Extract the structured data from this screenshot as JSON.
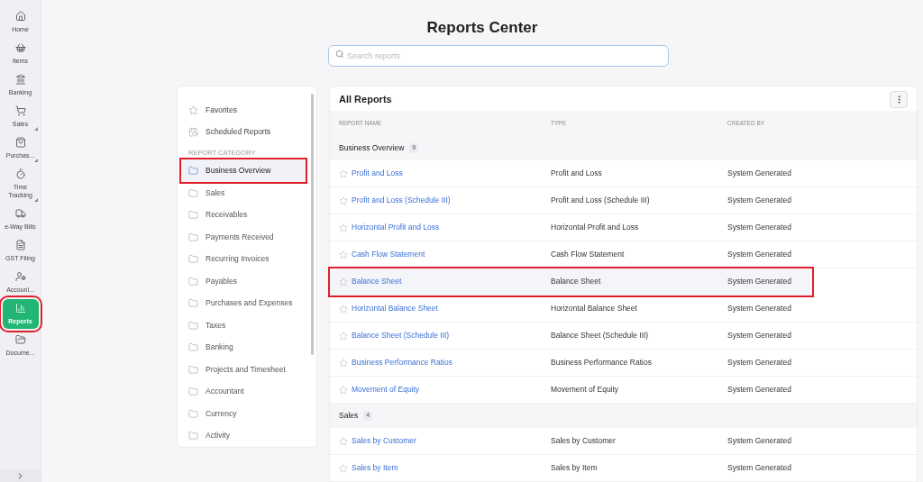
{
  "nav": {
    "items": [
      {
        "label": "Home",
        "selected": false,
        "expandable": false,
        "annotated": false
      },
      {
        "label": "Items",
        "selected": false,
        "expandable": false,
        "annotated": false
      },
      {
        "label": "Banking",
        "selected": false,
        "expandable": false,
        "annotated": false
      },
      {
        "label": "Sales",
        "selected": false,
        "expandable": true,
        "annotated": false
      },
      {
        "label": "Purchas...",
        "selected": false,
        "expandable": true,
        "annotated": false
      },
      {
        "label": "Time Tracking",
        "selected": false,
        "expandable": true,
        "annotated": false
      },
      {
        "label": "e-Way Bills",
        "selected": false,
        "expandable": false,
        "annotated": false
      },
      {
        "label": "GST Filing",
        "selected": false,
        "expandable": false,
        "annotated": false
      },
      {
        "label": "Accounl...",
        "selected": false,
        "expandable": false,
        "annotated": false
      },
      {
        "label": "Reports",
        "selected": true,
        "expandable": false,
        "annotated": true
      },
      {
        "label": "Docume...",
        "selected": false,
        "expandable": false,
        "annotated": false
      }
    ]
  },
  "title": "Reports Center",
  "search": {
    "placeholder": "Search reports"
  },
  "categories": {
    "top": [
      {
        "label": "Favorites"
      },
      {
        "label": "Scheduled Reports"
      }
    ],
    "heading": "REPORT CATEGORY",
    "items": [
      {
        "label": "Business Overview",
        "selected": true,
        "annotated": true
      },
      {
        "label": "Sales",
        "selected": false,
        "annotated": false
      },
      {
        "label": "Receivables",
        "selected": false,
        "annotated": false
      },
      {
        "label": "Payments Received",
        "selected": false,
        "annotated": false
      },
      {
        "label": "Recurring Invoices",
        "selected": false,
        "annotated": false
      },
      {
        "label": "Payables",
        "selected": false,
        "annotated": false
      },
      {
        "label": "Purchases and Expenses",
        "selected": false,
        "annotated": false
      },
      {
        "label": "Taxes",
        "selected": false,
        "annotated": false
      },
      {
        "label": "Banking",
        "selected": false,
        "annotated": false
      },
      {
        "label": "Projects and Timesheet",
        "selected": false,
        "annotated": false
      },
      {
        "label": "Accountant",
        "selected": false,
        "annotated": false
      },
      {
        "label": "Currency",
        "selected": false,
        "annotated": false
      },
      {
        "label": "Activity",
        "selected": false,
        "annotated": false
      }
    ]
  },
  "reports": {
    "title": "All Reports",
    "columns": [
      "REPORT NAME",
      "TYPE",
      "CREATED BY"
    ],
    "groups": [
      {
        "name": "Business Overview",
        "count": "9",
        "rows": [
          {
            "name": "Profit and Loss",
            "type": "Profit and Loss",
            "created_by": "System Generated",
            "annotated": false
          },
          {
            "name": "Profit and Loss (Schedule III)",
            "type": "Profit and Loss (Schedule III)",
            "created_by": "System Generated",
            "annotated": false
          },
          {
            "name": "Horizontal Profit and Loss",
            "type": "Horizontal Profit and Loss",
            "created_by": "System Generated",
            "annotated": false
          },
          {
            "name": "Cash Flow Statement",
            "type": "Cash Flow Statement",
            "created_by": "System Generated",
            "annotated": false
          },
          {
            "name": "Balance Sheet",
            "type": "Balance Sheet",
            "created_by": "System Generated",
            "annotated": true
          },
          {
            "name": "Horizontal Balance Sheet",
            "type": "Horizontal Balance Sheet",
            "created_by": "System Generated",
            "annotated": false
          },
          {
            "name": "Balance Sheet (Schedule III)",
            "type": "Balance Sheet (Schedule III)",
            "created_by": "System Generated",
            "annotated": false
          },
          {
            "name": "Business Performance Ratios",
            "type": "Business Performance Ratios",
            "created_by": "System Generated",
            "annotated": false
          },
          {
            "name": "Movement of Equity",
            "type": "Movement of Equity",
            "created_by": "System Generated",
            "annotated": false
          }
        ]
      },
      {
        "name": "Sales",
        "count": "4",
        "rows": [
          {
            "name": "Sales by Customer",
            "type": "Sales by Customer",
            "created_by": "System Generated",
            "annotated": false
          },
          {
            "name": "Sales by Item",
            "type": "Sales by Item",
            "created_by": "System Generated",
            "annotated": false
          }
        ]
      }
    ]
  }
}
